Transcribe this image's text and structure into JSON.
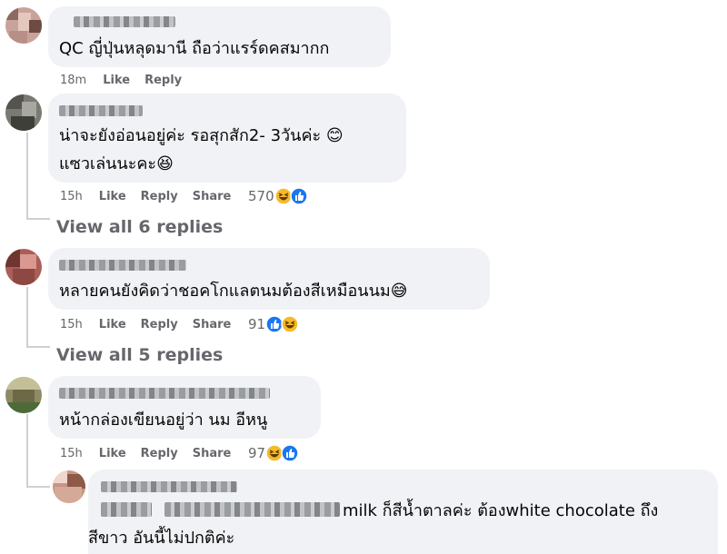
{
  "comments": [
    {
      "text_lines": [
        "QC ญี่ปุ่นหลุดมานี ถือว่าแรร์ดคสมากก"
      ],
      "time": "18m",
      "actions": [
        "Like",
        "Reply"
      ]
    },
    {
      "text_lines": [
        "น่าจะยังอ่อนอยู่ค่ะ รอสุกสัก2- 3วันค่ะ 😊",
        "แซวเล่นนะคะ😆"
      ],
      "time": "15h",
      "actions": [
        "Like",
        "Reply",
        "Share"
      ],
      "reaction_count": "570",
      "reactions": [
        "haha",
        "like"
      ],
      "view_replies": "View all 6 replies"
    },
    {
      "text_lines": [
        "หลายคนยังคิดว่าชอคโกแลตนมต้องสีเหมือนนม😅"
      ],
      "time": "15h",
      "actions": [
        "Like",
        "Reply",
        "Share"
      ],
      "reaction_count": "91",
      "reactions": [
        "like",
        "haha"
      ],
      "view_replies": "View all 5 replies"
    },
    {
      "text_lines": [
        "หน้ากล่องเขียนอยู่ว่า นม อีหนู"
      ],
      "time": "15h",
      "actions": [
        "Like",
        "Reply",
        "Share"
      ],
      "reaction_count": "97",
      "reactions": [
        "haha",
        "like"
      ]
    }
  ],
  "reply": {
    "text_line1": "milk ก็สีน้ำตาลค่ะ ต้องwhite chocolate ถึง",
    "text_line2": "สีขาว อันนี้ไม่ปกติค่ะ"
  },
  "colors": {
    "bubble": "#f0f2f5",
    "meta_text": "#65676b",
    "like_blue": "#1877f2",
    "haha_yellow": "#f7b928"
  },
  "icons": [
    "haha-reaction-icon",
    "like-reaction-icon"
  ]
}
